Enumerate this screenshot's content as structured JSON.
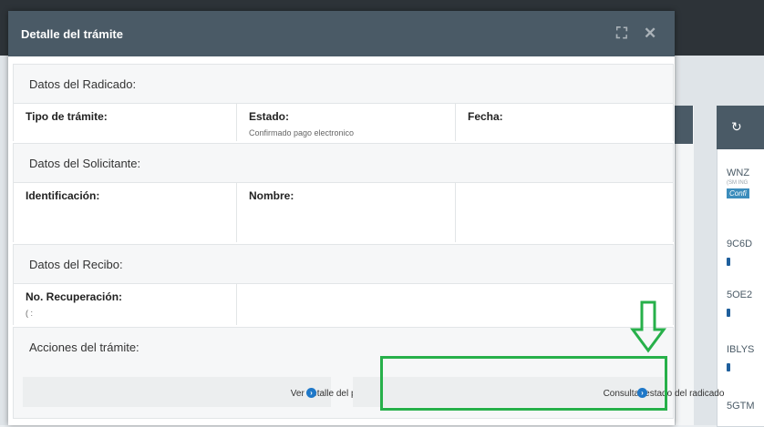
{
  "background": {
    "refresh_icon": "refresh-icon",
    "list_items": [
      {
        "code": "WNZ",
        "sub": "(SM ING",
        "tag": "Confi"
      },
      {
        "code": "9C6D"
      },
      {
        "code": "5OE2"
      },
      {
        "code": "IBLYS"
      },
      {
        "code": "5GTM"
      }
    ]
  },
  "modal": {
    "title": "Detalle del trámite",
    "expand_icon": "expand-icon",
    "close_icon": "close-icon"
  },
  "radicado": {
    "heading": "Datos del Radicado:",
    "fields": [
      {
        "label": "Tipo de trámite:",
        "value": ""
      },
      {
        "label": "Estado:",
        "value": "Confirmado pago electronico"
      },
      {
        "label": "Fecha:",
        "value": ""
      }
    ]
  },
  "solicitante": {
    "heading": "Datos del Solicitante:",
    "fields": [
      {
        "label": "Identificación:",
        "value": ""
      },
      {
        "label": "Nombre:",
        "value": ""
      }
    ]
  },
  "recibo": {
    "heading": "Datos del Recibo:",
    "fields": [
      {
        "label": "No. Recuperación:",
        "value": "(       :"
      }
    ]
  },
  "acciones": {
    "heading": "Acciones del trámite:",
    "buttons": [
      {
        "label": "Ver detalle del pago",
        "icon": "chevron-right-circle-icon"
      },
      {
        "label": "Consultar estado del radicado",
        "icon": "chevron-right-circle-icon"
      }
    ]
  },
  "colors": {
    "header": "#4a5a66",
    "accent": "#1f78c8",
    "highlight": "#27b04a"
  }
}
